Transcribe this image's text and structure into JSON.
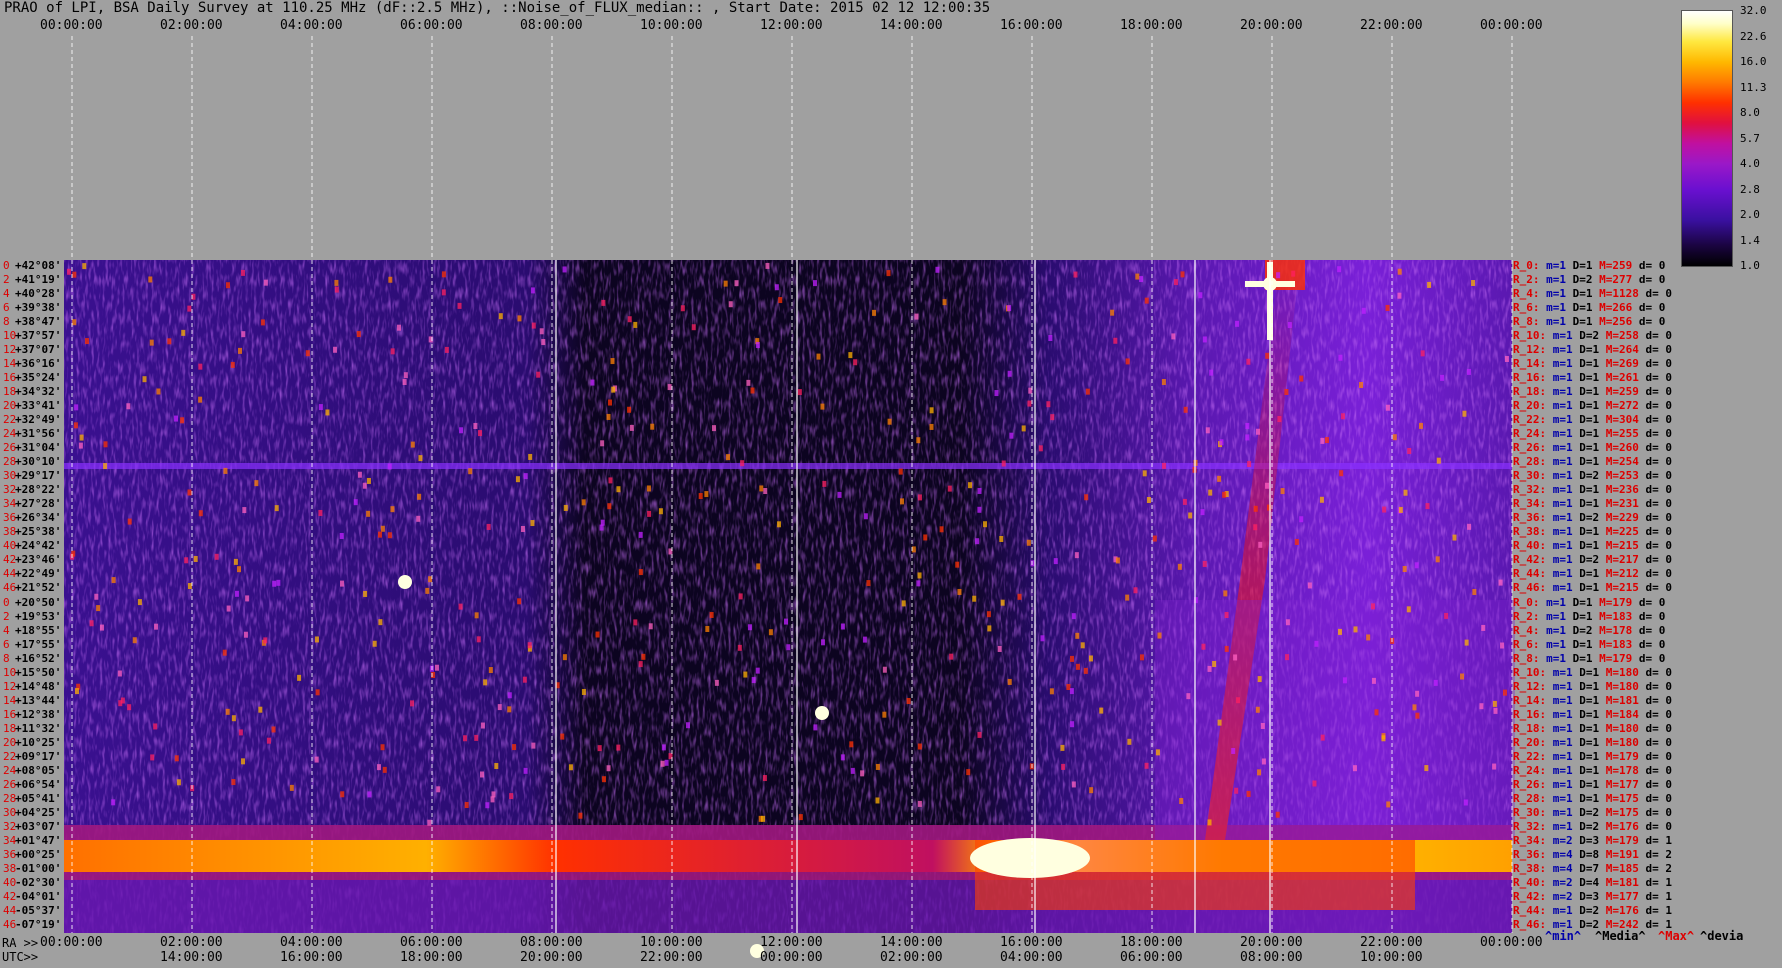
{
  "title": "PRAO of LPI, BSA Daily Survey at 110.25 MHz (dF::2.5 MHz), ::Noise_of_FLUX_median:: , Start Date: 2015 02 12 12:00:35",
  "chart_data": {
    "type": "heatmap",
    "top_axis_labels": [
      "00:00:00",
      "02:00:00",
      "04:00:00",
      "06:00:00",
      "08:00:00",
      "10:00:00",
      "12:00:00",
      "14:00:00",
      "16:00:00",
      "18:00:00",
      "20:00:00",
      "22:00:00",
      "00:00:00"
    ],
    "ra_axis_prefix": "RA >>",
    "ra_axis_labels": [
      "00:00:00",
      "02:00:00",
      "04:00:00",
      "06:00:00",
      "08:00:00",
      "10:00:00",
      "12:00:00",
      "14:00:00",
      "16:00:00",
      "18:00:00",
      "20:00:00",
      "22:00:00",
      "00:00:00"
    ],
    "utc_axis_prefix": "UTC>>",
    "utc_axis_labels": [
      "14:00:00",
      "16:00:00",
      "18:00:00",
      "20:00:00",
      "22:00:00",
      "00:00:00",
      "02:00:00",
      "04:00:00",
      "06:00:00",
      "08:00:00",
      "10:00:00"
    ],
    "colorbar_labels": [
      "32.0",
      "22.6",
      "16.0",
      "11.3",
      "8.0",
      "5.7",
      "4.0",
      "2.8",
      "2.0",
      "1.4",
      "1.0"
    ],
    "declinations": [
      "+42°08'",
      "+41°19'",
      "+40°28'",
      "+39°38'",
      "+38°47'",
      "+37°57'",
      "+37°07'",
      "+36°16'",
      "+35°24'",
      "+34°32'",
      "+33°41'",
      "+32°49'",
      "+31°56'",
      "+31°04'",
      "+30°10'",
      "+29°17'",
      "+28°22'",
      "+27°28'",
      "+26°34'",
      "+25°38'",
      "+24°42'",
      "+23°46'",
      "+22°49'",
      "+21°52'",
      "+20°50'",
      "+19°53'",
      "+18°55'",
      "+17°55'",
      "+16°52'",
      "+15°50'",
      "+14°48'",
      "+13°44'",
      "+12°38'",
      "+11°32'",
      "+10°25'",
      "+09°17'",
      "+08°05'",
      "+06°54'",
      "+05°41'",
      "+04°25'",
      "+03°07'",
      "+01°47'",
      "+00°25'",
      "-01°00'",
      "-02°30'",
      "-04°01'",
      "-05°37'",
      "-07°19'"
    ],
    "row_indices": [
      "0",
      "2",
      "4",
      "6",
      "8",
      "10",
      "12",
      "14",
      "16",
      "18",
      "20",
      "22",
      "24",
      "26",
      "28",
      "30",
      "32",
      "34",
      "36",
      "38",
      "40",
      "42",
      "44",
      "46",
      "0",
      "2",
      "4",
      "6",
      "8",
      "10",
      "12",
      "14",
      "16",
      "18",
      "20",
      "22",
      "24",
      "26",
      "28",
      "30",
      "32",
      "34",
      "36",
      "38",
      "40",
      "42",
      "44",
      "46"
    ],
    "row_stats": [
      {
        "r": "R_0:",
        "m": "m=1",
        "D": "D=1",
        "M": "M=259",
        "d": "d= 0"
      },
      {
        "r": "R_2:",
        "m": "m=1",
        "D": "D=2",
        "M": "M=277",
        "d": "d= 0"
      },
      {
        "r": "R_4:",
        "m": "m=1",
        "D": "D=1",
        "M": "M=1128",
        "d": "d= 0"
      },
      {
        "r": "R_6:",
        "m": "m=1",
        "D": "D=1",
        "M": "M=266",
        "d": "d= 0"
      },
      {
        "r": "R_8:",
        "m": "m=1",
        "D": "D=1",
        "M": "M=256",
        "d": "d= 0"
      },
      {
        "r": "R_10:",
        "m": "m=1",
        "D": "D=2",
        "M": "M=258",
        "d": "d= 0"
      },
      {
        "r": "R_12:",
        "m": "m=1",
        "D": "D=1",
        "M": "M=264",
        "d": "d= 0"
      },
      {
        "r": "R_14:",
        "m": "m=1",
        "D": "D=1",
        "M": "M=269",
        "d": "d= 0"
      },
      {
        "r": "R_16:",
        "m": "m=1",
        "D": "D=1",
        "M": "M=261",
        "d": "d= 0"
      },
      {
        "r": "R_18:",
        "m": "m=1",
        "D": "D=1",
        "M": "M=259",
        "d": "d= 0"
      },
      {
        "r": "R_20:",
        "m": "m=1",
        "D": "D=1",
        "M": "M=272",
        "d": "d= 0"
      },
      {
        "r": "R_22:",
        "m": "m=1",
        "D": "D=1",
        "M": "M=304",
        "d": "d= 0"
      },
      {
        "r": "R_24:",
        "m": "m=1",
        "D": "D=1",
        "M": "M=255",
        "d": "d= 0"
      },
      {
        "r": "R_26:",
        "m": "m=1",
        "D": "D=1",
        "M": "M=260",
        "d": "d= 0"
      },
      {
        "r": "R_28:",
        "m": "m=1",
        "D": "D=1",
        "M": "M=254",
        "d": "d= 0"
      },
      {
        "r": "R_30:",
        "m": "m=1",
        "D": "D=2",
        "M": "M=253",
        "d": "d= 0"
      },
      {
        "r": "R_32:",
        "m": "m=1",
        "D": "D=1",
        "M": "M=236",
        "d": "d= 0"
      },
      {
        "r": "R_34:",
        "m": "m=1",
        "D": "D=1",
        "M": "M=231",
        "d": "d= 0"
      },
      {
        "r": "R_36:",
        "m": "m=1",
        "D": "D=2",
        "M": "M=229",
        "d": "d= 0"
      },
      {
        "r": "R_38:",
        "m": "m=1",
        "D": "D=1",
        "M": "M=225",
        "d": "d= 0"
      },
      {
        "r": "R_40:",
        "m": "m=1",
        "D": "D=1",
        "M": "M=215",
        "d": "d= 0"
      },
      {
        "r": "R_42:",
        "m": "m=1",
        "D": "D=2",
        "M": "M=217",
        "d": "d= 0"
      },
      {
        "r": "R_44:",
        "m": "m=1",
        "D": "D=1",
        "M": "M=212",
        "d": "d= 0"
      },
      {
        "r": "R_46:",
        "m": "m=1",
        "D": "D=1",
        "M": "M=215",
        "d": "d= 0"
      },
      {
        "r": "R_0:",
        "m": "m=1",
        "D": "D=1",
        "M": "M=179",
        "d": "d= 0"
      },
      {
        "r": "R_2:",
        "m": "m=1",
        "D": "D=1",
        "M": "M=183",
        "d": "d= 0"
      },
      {
        "r": "R_4:",
        "m": "m=1",
        "D": "D=2",
        "M": "M=178",
        "d": "d= 0"
      },
      {
        "r": "R_6:",
        "m": "m=1",
        "D": "D=1",
        "M": "M=183",
        "d": "d= 0"
      },
      {
        "r": "R_8:",
        "m": "m=1",
        "D": "D=1",
        "M": "M=179",
        "d": "d= 0"
      },
      {
        "r": "R_10:",
        "m": "m=1",
        "D": "D=1",
        "M": "M=180",
        "d": "d= 0"
      },
      {
        "r": "R_12:",
        "m": "m=1",
        "D": "D=1",
        "M": "M=180",
        "d": "d= 0"
      },
      {
        "r": "R_14:",
        "m": "m=1",
        "D": "D=1",
        "M": "M=181",
        "d": "d= 0"
      },
      {
        "r": "R_16:",
        "m": "m=1",
        "D": "D=1",
        "M": "M=184",
        "d": "d= 0"
      },
      {
        "r": "R_18:",
        "m": "m=1",
        "D": "D=1",
        "M": "M=180",
        "d": "d= 0"
      },
      {
        "r": "R_20:",
        "m": "m=1",
        "D": "D=1",
        "M": "M=180",
        "d": "d= 0"
      },
      {
        "r": "R_22:",
        "m": "m=1",
        "D": "D=1",
        "M": "M=179",
        "d": "d= 0"
      },
      {
        "r": "R_24:",
        "m": "m=1",
        "D": "D=1",
        "M": "M=178",
        "d": "d= 0"
      },
      {
        "r": "R_26:",
        "m": "m=1",
        "D": "D=1",
        "M": "M=177",
        "d": "d= 0"
      },
      {
        "r": "R_28:",
        "m": "m=1",
        "D": "D=1",
        "M": "M=175",
        "d": "d= 0"
      },
      {
        "r": "R_30:",
        "m": "m=1",
        "D": "D=2",
        "M": "M=175",
        "d": "d= 0"
      },
      {
        "r": "R_32:",
        "m": "m=1",
        "D": "D=2",
        "M": "M=176",
        "d": "d= 0"
      },
      {
        "r": "R_34:",
        "m": "m=2",
        "D": "D=3",
        "M": "M=179",
        "d": "d= 1"
      },
      {
        "r": "R_36:",
        "m": "m=4",
        "D": "D=8",
        "M": "M=191",
        "d": "d= 2"
      },
      {
        "r": "R_38:",
        "m": "m=4",
        "D": "D=7",
        "M": "M=185",
        "d": "d= 2"
      },
      {
        "r": "R_40:",
        "m": "m=2",
        "D": "D=4",
        "M": "M=181",
        "d": "d= 1"
      },
      {
        "r": "R_42:",
        "m": "m=2",
        "D": "D=3",
        "M": "M=177",
        "d": "d= 1"
      },
      {
        "r": "R_44:",
        "m": "m=1",
        "D": "D=2",
        "M": "M=176",
        "d": "d= 1"
      },
      {
        "r": "R_46:",
        "m": "m=1",
        "D": "D=2",
        "M": "M=242",
        "d": "d= 1"
      }
    ],
    "footer_legend": {
      "min": "^min^",
      "media": "^Media^",
      "max": "^Max^",
      "devia": "^devia"
    },
    "colors": {
      "low": "#000000",
      "mid": "#7a10e0",
      "high": "#ff2000",
      "peak": "#ffffff"
    }
  }
}
